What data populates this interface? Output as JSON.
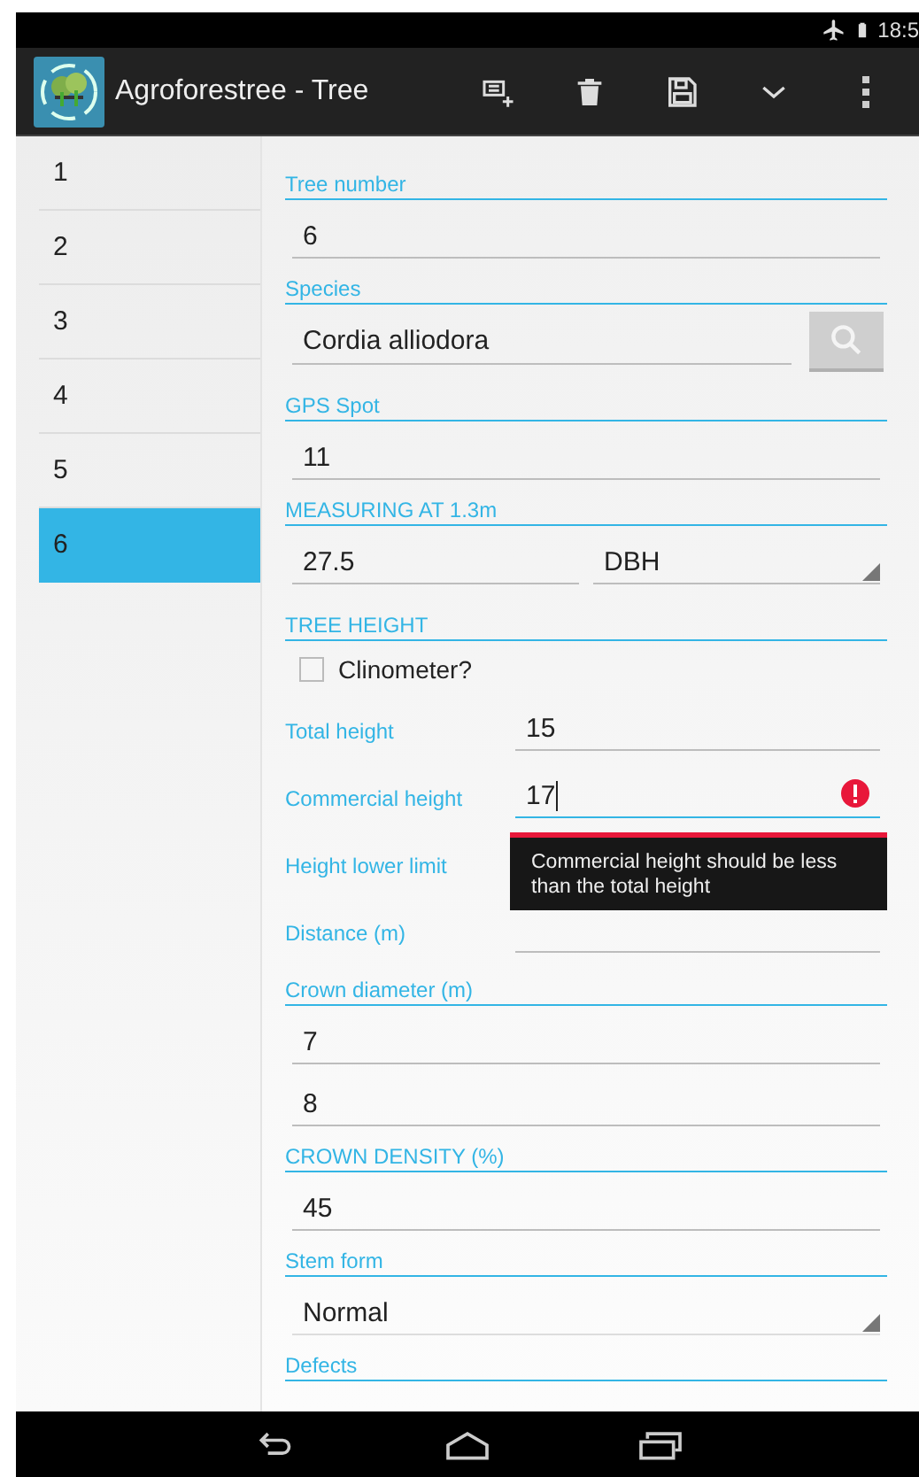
{
  "status_bar": {
    "time": "18:5"
  },
  "action_bar": {
    "title": "Agroforestree - Tree"
  },
  "tree_list": [
    {
      "label": "1",
      "selected": false
    },
    {
      "label": "2",
      "selected": false
    },
    {
      "label": "3",
      "selected": false
    },
    {
      "label": "4",
      "selected": false
    },
    {
      "label": "5",
      "selected": false
    },
    {
      "label": "6",
      "selected": true
    }
  ],
  "form": [
    {
      "kind": "header",
      "label": "Tree number"
    },
    {
      "kind": "text",
      "value": "6"
    },
    {
      "kind": "header",
      "label": "Species"
    },
    {
      "kind": "search",
      "value": "Cordia alliodora"
    },
    {
      "kind": "header",
      "label": "GPS Spot"
    },
    {
      "kind": "text",
      "value": "11"
    },
    {
      "kind": "header",
      "label": "MEASURING AT 1.3m"
    },
    {
      "kind": "split",
      "value": "27.5",
      "option": "DBH"
    },
    {
      "kind": "header",
      "label": "TREE HEIGHT"
    },
    {
      "kind": "checkbox",
      "label": "Clinometer?",
      "checked": false
    },
    {
      "kind": "labeled",
      "label": "Total height",
      "value": "15",
      "focused": false
    },
    {
      "kind": "labeled",
      "label": "Commercial height",
      "value": "17",
      "focused": true,
      "error": "Commercial height should be less than the total height"
    },
    {
      "kind": "labeled",
      "label": "Height lower limit"
    },
    {
      "kind": "labeled",
      "label": "Distance (m)",
      "focused": false
    },
    {
      "kind": "header",
      "label": "Crown diameter (m)"
    },
    {
      "kind": "text",
      "value": "7"
    },
    {
      "kind": "text",
      "value": "8"
    },
    {
      "kind": "header",
      "label": "CROWN DENSITY (%)"
    },
    {
      "kind": "text",
      "value": "45"
    },
    {
      "kind": "header",
      "label": "Stem form"
    },
    {
      "kind": "spinner",
      "value": "Normal"
    },
    {
      "kind": "header",
      "label": "Defects"
    }
  ]
}
